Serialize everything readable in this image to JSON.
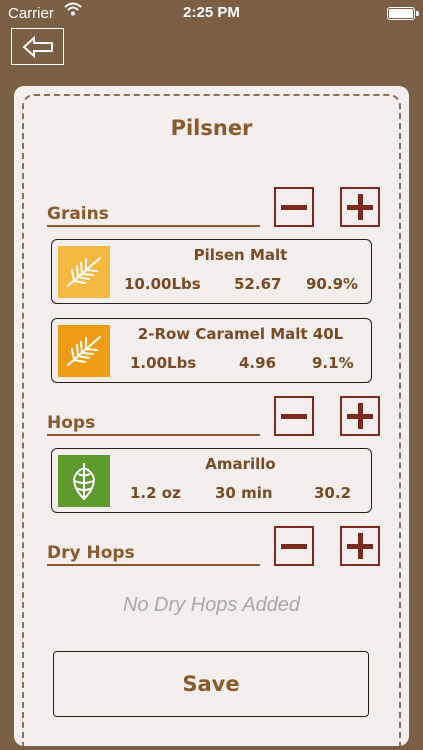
{
  "status_bar": {
    "carrier": "Carrier",
    "time": "2:25 PM"
  },
  "title": "Pilsner",
  "grains": {
    "label": "Grains",
    "items": [
      {
        "name": "Pilsen Malt",
        "amount": "10.00Lbs",
        "value": "52.67",
        "percent": "90.9%",
        "icon": "wheat-icon",
        "color": "#f5b840"
      },
      {
        "name": "2-Row Caramel Malt 40L",
        "amount": "1.00Lbs",
        "value": "4.96",
        "percent": "9.1%",
        "icon": "wheat-icon",
        "color": "#ee9b15"
      }
    ]
  },
  "hops": {
    "label": "Hops",
    "items": [
      {
        "name": "Amarillo",
        "amount": "1.2 oz",
        "time": "30 min",
        "value": "30.2",
        "icon": "hop-icon",
        "color": "#5e9a2e"
      }
    ]
  },
  "dry_hops": {
    "label": "Dry Hops",
    "empty_text": "No Dry Hops Added"
  },
  "save_label": "Save",
  "colors": {
    "background": "#7a5f45",
    "card": "#f4efee",
    "accent_text": "#8a5a2b",
    "button_border": "#7a2a1f"
  }
}
